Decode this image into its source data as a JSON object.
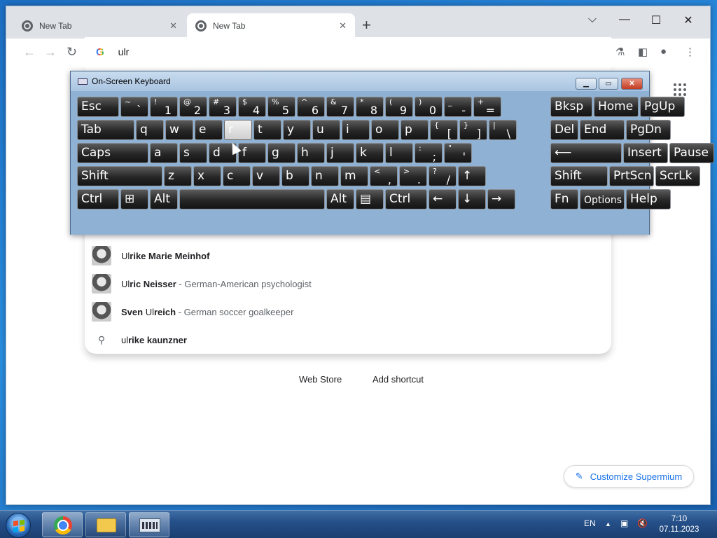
{
  "tabs": [
    {
      "title": "New Tab",
      "active": false
    },
    {
      "title": "New Tab",
      "active": true
    }
  ],
  "omnibox": {
    "value": "ulr",
    "engine_icon": "google-g-icon"
  },
  "suggestions": [
    {
      "match": "Ul",
      "rest": "rike Marie Meinhof",
      "desc": "",
      "kind": "entity"
    },
    {
      "match": "Ul",
      "rest": "ric Neisser",
      "desc": "German-American psychologist",
      "kind": "entity"
    },
    {
      "prefix": "Sven ",
      "match": "Ul",
      "rest": "reich",
      "desc": "German soccer goalkeeper",
      "kind": "entity"
    },
    {
      "match": "ul",
      "rest": "rike kaunzner",
      "desc": "",
      "kind": "search"
    }
  ],
  "shortcuts": [
    "Web Store",
    "Add shortcut"
  ],
  "customize_label": "Customize Supermium",
  "osk": {
    "title": "On-Screen Keyboard",
    "rows": [
      [
        {
          "l": "Esc"
        },
        {
          "s": "~",
          "l": "`"
        },
        {
          "s": "!",
          "l": "1"
        },
        {
          "s": "@",
          "l": "2"
        },
        {
          "s": "#",
          "l": "3"
        },
        {
          "s": "$",
          "l": "4"
        },
        {
          "s": "%",
          "l": "5"
        },
        {
          "s": "^",
          "l": "6"
        },
        {
          "s": "&",
          "l": "7"
        },
        {
          "s": "*",
          "l": "8"
        },
        {
          "s": "(",
          "l": "9"
        },
        {
          "s": ")",
          "l": "0"
        },
        {
          "s": "_",
          "l": "-"
        },
        {
          "s": "+",
          "l": "="
        },
        {
          "l": "Bksp"
        },
        {
          "l": "Home"
        },
        {
          "l": "PgUp"
        }
      ],
      [
        {
          "l": "Tab"
        },
        {
          "l": "q"
        },
        {
          "l": "w"
        },
        {
          "l": "e"
        },
        {
          "l": "r",
          "pressed": true
        },
        {
          "l": "t"
        },
        {
          "l": "y"
        },
        {
          "l": "u"
        },
        {
          "l": "i"
        },
        {
          "l": "o"
        },
        {
          "l": "p"
        },
        {
          "s": "{",
          "l": "["
        },
        {
          "s": "}",
          "l": "]"
        },
        {
          "s": "|",
          "l": "\\"
        },
        {
          "l": "Del"
        },
        {
          "l": "End"
        },
        {
          "l": "PgDn"
        }
      ],
      [
        {
          "l": "Caps"
        },
        {
          "l": "a"
        },
        {
          "l": "s"
        },
        {
          "l": "d"
        },
        {
          "l": "f"
        },
        {
          "l": "g"
        },
        {
          "l": "h"
        },
        {
          "l": "j"
        },
        {
          "l": "k"
        },
        {
          "l": "l"
        },
        {
          "s": ":",
          "l": ";"
        },
        {
          "s": "\"",
          "l": "'"
        },
        {
          "l": "⟵"
        },
        {
          "l": "Insert"
        },
        {
          "l": "Pause"
        }
      ],
      [
        {
          "l": "Shift"
        },
        {
          "l": "z"
        },
        {
          "l": "x"
        },
        {
          "l": "c"
        },
        {
          "l": "v"
        },
        {
          "l": "b"
        },
        {
          "l": "n"
        },
        {
          "l": "m"
        },
        {
          "s": "<",
          "l": ","
        },
        {
          "s": ">",
          "l": "."
        },
        {
          "s": "?",
          "l": "/"
        },
        {
          "l": "↑"
        },
        {
          "l": "Shift"
        },
        {
          "l": "PrtScn"
        },
        {
          "l": "ScrLk"
        }
      ],
      [
        {
          "l": "Ctrl"
        },
        {
          "l": "⊞"
        },
        {
          "l": "Alt"
        },
        {
          "l": ""
        },
        {
          "l": "Alt"
        },
        {
          "l": "▤"
        },
        {
          "l": "Ctrl"
        },
        {
          "l": "←"
        },
        {
          "l": "↓"
        },
        {
          "l": "→"
        },
        {
          "l": "Fn"
        },
        {
          "l": "Options",
          "small": true
        },
        {
          "l": "Help"
        }
      ]
    ]
  },
  "tray": {
    "lang": "EN",
    "time": "7:10",
    "date": "07.11.2023"
  }
}
